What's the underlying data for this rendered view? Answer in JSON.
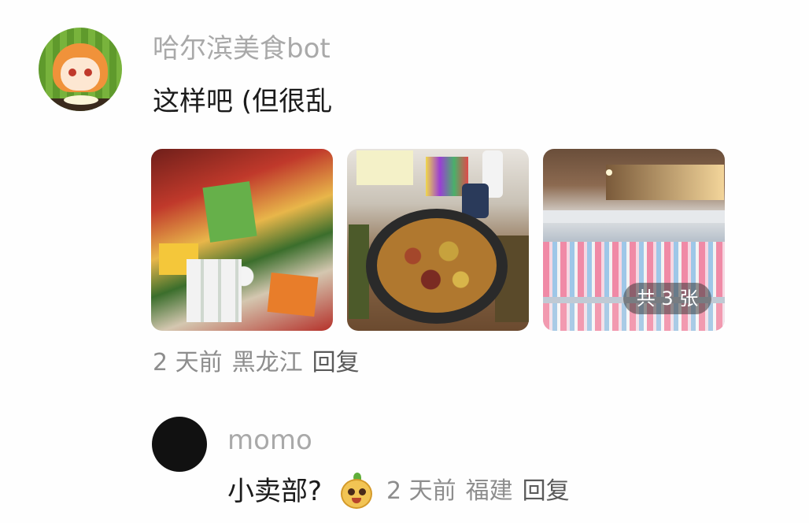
{
  "comment": {
    "author": "哈尔滨美食bot",
    "text": "这样吧 (但很乱",
    "photos": [
      {
        "alt": "snacks"
      },
      {
        "alt": "dish"
      },
      {
        "alt": "shelf"
      }
    ],
    "photo_count_badge": "共 3 张",
    "time": "2 天前",
    "location": "黑龙江",
    "reply_label": "回复"
  },
  "reply": {
    "author": "momo",
    "text": "小卖部?",
    "emoji": "bean-emoji",
    "time": "2 天前",
    "location": "福建",
    "reply_label": "回复"
  }
}
